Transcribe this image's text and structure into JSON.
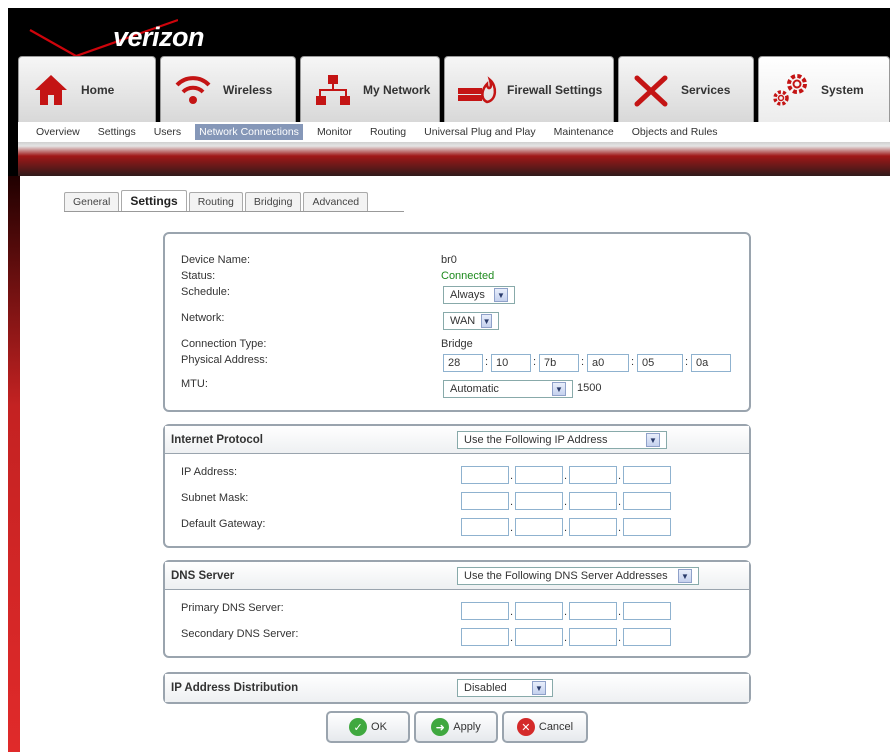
{
  "brand": {
    "logo_text": "verizon",
    "logo_color": "#cd040b"
  },
  "main_tabs": [
    {
      "label": "Home",
      "icon": "home-icon"
    },
    {
      "label": "Wireless",
      "icon": "wireless-icon"
    },
    {
      "label": "My Network",
      "icon": "network-icon"
    },
    {
      "label": "Firewall Settings",
      "icon": "firewall-icon"
    },
    {
      "label": "Services",
      "icon": "services-icon"
    },
    {
      "label": "System",
      "icon": "gears-icon",
      "active": true
    }
  ],
  "sub_nav": [
    {
      "label": "Overview"
    },
    {
      "label": "Settings"
    },
    {
      "label": "Users"
    },
    {
      "label": "Network Connections",
      "active": true
    },
    {
      "label": "Monitor"
    },
    {
      "label": "Routing"
    },
    {
      "label": "Universal Plug and Play"
    },
    {
      "label": "Maintenance"
    },
    {
      "label": "Objects and Rules"
    }
  ],
  "sub_tabs": [
    {
      "label": "General"
    },
    {
      "label": "Settings",
      "active": true
    },
    {
      "label": "Routing"
    },
    {
      "label": "Bridging"
    },
    {
      "label": "Advanced"
    }
  ],
  "device": {
    "name_label": "Device Name:",
    "name_value": "br0",
    "status_label": "Status:",
    "status_value": "Connected",
    "schedule_label": "Schedule:",
    "schedule_value": "Always",
    "network_label": "Network:",
    "network_value": "WAN",
    "conn_type_label": "Connection Type:",
    "conn_type_value": "Bridge",
    "phys_label": "Physical Address:",
    "mac": [
      "28",
      "10",
      "7b",
      "a0",
      "05",
      "0a"
    ],
    "mtu_label": "MTU:",
    "mtu_mode": "Automatic",
    "mtu_value": "1500"
  },
  "internet_protocol": {
    "title": "Internet Protocol",
    "mode": "Use the Following IP Address",
    "fields": [
      "IP Address:",
      "Subnet Mask:",
      "Default Gateway:"
    ]
  },
  "dns_server": {
    "title": "DNS Server",
    "mode": "Use the Following DNS Server Addresses",
    "fields": [
      "Primary DNS Server:",
      "Secondary DNS Server:"
    ]
  },
  "ip_distribution": {
    "title": "IP Address Distribution",
    "mode": "Disabled"
  },
  "buttons": {
    "ok": "OK",
    "apply": "Apply",
    "cancel": "Cancel"
  }
}
